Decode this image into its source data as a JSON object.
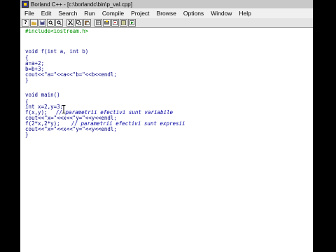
{
  "window": {
    "title": "Borland C++ - [c:\\borlandc\\bin\\p_val.cpp]"
  },
  "menu": [
    "File",
    "Edit",
    "Search",
    "Run",
    "Compile",
    "Project",
    "Browse",
    "Options",
    "Window",
    "Help"
  ],
  "toolbar": {
    "icons": [
      "help-icon",
      "open-icon",
      "save-icon",
      "search-icon",
      "search-again-icon",
      "cut-icon",
      "copy-icon",
      "paste-icon",
      "compile-icon",
      "make-icon",
      "step-over-icon",
      "trace-icon",
      "run-icon"
    ]
  },
  "editor": {
    "lines": [
      "#include<iostream.h>",
      "void f(int a, int b)",
      "{",
      "a=a+2;",
      "b=b+3;",
      "cout<<\"a=\"<<a<<\"b=\"<<b<<endl;",
      "}",
      "void main()",
      "{",
      "int x=2,y=3;",
      "f(x,y);",
      "// parametrii efectivi sunt variabile",
      "cout<<\"x=\"<<x<<\"y=\"<<y<<endl;",
      "f(2*x,2*y);",
      "// parametrii efectivi sunt expresii",
      "cout<<\"x=\"<<x<<\"y=\"<<y<<endl;",
      "}"
    ]
  },
  "colors": {
    "directive": "#009000",
    "code": "#000080",
    "comment": "#0000a0"
  }
}
